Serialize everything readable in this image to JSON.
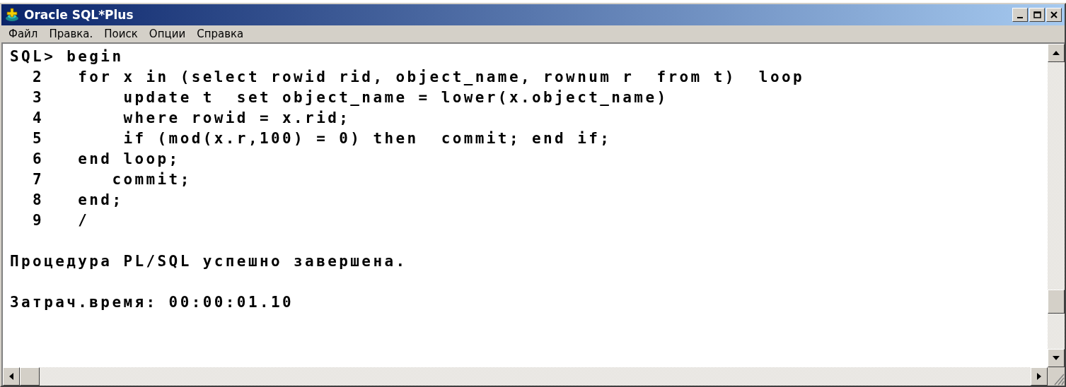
{
  "window": {
    "title": "Oracle SQL*Plus"
  },
  "menu": [
    "Файл",
    "Правка.",
    "Поиск",
    "Опции",
    "Справка"
  ],
  "console": {
    "lines": [
      {
        "kind": "input",
        "text": "SQL> begin"
      },
      {
        "kind": "input",
        "text": "  2   for x in (select rowid rid, object_name, rownum r  from t)  loop"
      },
      {
        "kind": "input",
        "text": "  3       update t  set object_name = lower(x.object_name)"
      },
      {
        "kind": "input",
        "text": "  4       where rowid = x.rid;"
      },
      {
        "kind": "input",
        "text": "  5       if (mod(x.r,100) = 0) then  commit; end if;"
      },
      {
        "kind": "input",
        "text": "  6   end loop;"
      },
      {
        "kind": "input",
        "text": "  7      commit;"
      },
      {
        "kind": "input",
        "text": "  8   end;"
      },
      {
        "kind": "input",
        "text": "  9   /"
      },
      {
        "kind": "output",
        "text": "Процедура PL/SQL успешно завершена."
      },
      {
        "kind": "output",
        "text": "Затрач.время: 00:00:01.10"
      }
    ]
  }
}
